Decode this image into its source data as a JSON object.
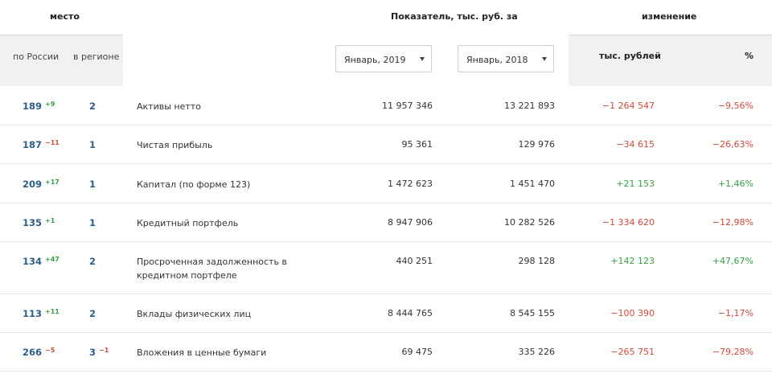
{
  "header": {
    "place_title": "место",
    "indicator_title": "Показатель, тыс. руб. за",
    "change_title": "изменение",
    "russia_label": "по России",
    "region_label": "в регионе",
    "change_abs_label": "тыс. рублей",
    "change_pct_label": "%"
  },
  "selects": {
    "current": "Январь, 2019",
    "previous": "Январь, 2018"
  },
  "rows": [
    {
      "rank": "189",
      "rank_delta": "+9",
      "region": "2",
      "region_delta": "",
      "name": "Активы нетто",
      "v2019": "11 957 346",
      "v2018": "13 221 893",
      "change_abs": "−1 264 547",
      "change_pct": "−9,56%"
    },
    {
      "rank": "187",
      "rank_delta": "−11",
      "region": "1",
      "region_delta": "",
      "name": "Чистая прибыль",
      "v2019": "95 361",
      "v2018": "129 976",
      "change_abs": "−34 615",
      "change_pct": "−26,63%"
    },
    {
      "rank": "209",
      "rank_delta": "+17",
      "region": "1",
      "region_delta": "",
      "name": "Капитал (по форме 123)",
      "v2019": "1 472 623",
      "v2018": "1 451 470",
      "change_abs": "+21 153",
      "change_pct": "+1,46%"
    },
    {
      "rank": "135",
      "rank_delta": "+1",
      "region": "1",
      "region_delta": "",
      "name": "Кредитный портфель",
      "v2019": "8 947 906",
      "v2018": "10 282 526",
      "change_abs": "−1 334 620",
      "change_pct": "−12,98%"
    },
    {
      "rank": "134",
      "rank_delta": "+47",
      "region": "2",
      "region_delta": "",
      "name": "Просроченная задолженность в кредитном портфеле",
      "v2019": "440 251",
      "v2018": "298 128",
      "change_abs": "+142 123",
      "change_pct": "+47,67%"
    },
    {
      "rank": "113",
      "rank_delta": "+11",
      "region": "2",
      "region_delta": "",
      "name": "Вклады физических лиц",
      "v2019": "8 444 765",
      "v2018": "8 545 155",
      "change_abs": "−100 390",
      "change_pct": "−1,17%"
    },
    {
      "rank": "266",
      "rank_delta": "−5",
      "region": "3",
      "region_delta": "−1",
      "name": "Вложения в ценные бумаги",
      "v2019": "69 475",
      "v2018": "335 226",
      "change_abs": "−265 751",
      "change_pct": "−79,28%"
    }
  ],
  "colors": {
    "up": "#3a9d4a",
    "down": "#d24a3a",
    "rank": "#2f5d8a"
  }
}
